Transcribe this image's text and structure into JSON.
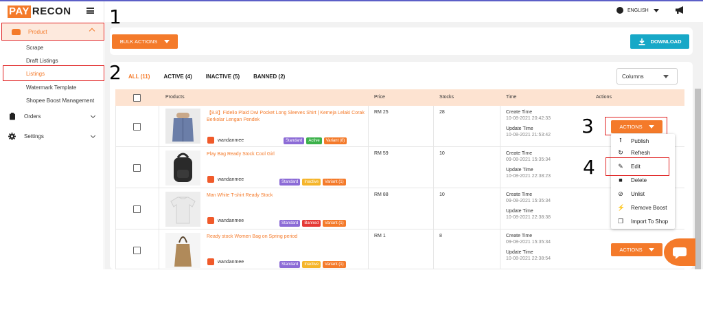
{
  "app": {
    "logo_pay": "PAY",
    "logo_recon": "RECON"
  },
  "sidebar": {
    "product_label": "Product",
    "sub_items": [
      {
        "label": "Scrape"
      },
      {
        "label": "Draft Listings"
      },
      {
        "label": "Listings"
      },
      {
        "label": "Watermark Template"
      },
      {
        "label": "Shopee Boost Management"
      }
    ],
    "orders_label": "Orders",
    "settings_label": "Settings"
  },
  "header": {
    "language": "ENGLISH"
  },
  "toolbar": {
    "bulk_actions": "BULK ACTIONS",
    "download": "DOWNLOAD"
  },
  "tabs": [
    {
      "label": "ALL (11)"
    },
    {
      "label": "ACTIVE (4)"
    },
    {
      "label": "INACTIVE (5)"
    },
    {
      "label": "BANNED (2)"
    }
  ],
  "columns_select": "Columns",
  "table": {
    "headers": {
      "products": "Products",
      "price": "Price",
      "stocks": "Stocks",
      "time": "Time",
      "actions": "Actions"
    },
    "create_label": "Create Time",
    "update_label": "Update Time",
    "rows": [
      {
        "name": "【8.8】Fidelio Plaid Dwi Pocket Long Sleeves Shirt | Kemeja Lelaki Corak Berkolar Lengan Pendek",
        "shop": "wandanmee",
        "type": "Standard",
        "status": "Active",
        "variant": "Variant (8)",
        "price": "RM 25",
        "stock": "28",
        "create": "10-08-2021 20:42:33",
        "update": "10-08-2021 21:53:42"
      },
      {
        "name": "Play Bag Ready Stock Cool Girl",
        "shop": "wandanmee",
        "type": "Standard",
        "status": "Inactive",
        "variant": "Variant (1)",
        "price": "RM 59",
        "stock": "10",
        "create": "09-08-2021 15:35:34",
        "update": "10-08-2021 22:38:23"
      },
      {
        "name": "Man White T-shirt Ready Stock",
        "shop": "wandanmee",
        "type": "Standard",
        "status": "Banned",
        "variant": "Variant (1)",
        "price": "RM 88",
        "stock": "10",
        "create": "09-08-2021 15:35:34",
        "update": "10-08-2021 22:38:38"
      },
      {
        "name": "Ready stock Women Bag on Spring period",
        "shop": "wandanmee",
        "type": "Standard",
        "status": "Inactive",
        "variant": "Variant (1)",
        "price": "RM 1",
        "stock": "8",
        "create": "09-08-2021 15:35:34",
        "update": "10-08-2021 22:38:54"
      }
    ]
  },
  "actions_label": "ACTIONS",
  "actions_menu": [
    {
      "label": "Publish",
      "icon": "publish-icon"
    },
    {
      "label": "Refresh",
      "icon": "refresh-icon"
    },
    {
      "label": "Edit",
      "icon": "edit-icon"
    },
    {
      "label": "Delete",
      "icon": "trash-icon"
    },
    {
      "label": "Unlist",
      "icon": "unlist-icon"
    },
    {
      "label": "Remove Boost",
      "icon": "bolt-icon"
    },
    {
      "label": "Import To Shop",
      "icon": "copy-icon"
    }
  ],
  "annotations": [
    "1",
    "2",
    "3",
    "4"
  ],
  "colors": {
    "accent": "#f47a2a",
    "download": "#17a8c7",
    "highlight": "#e02020"
  }
}
